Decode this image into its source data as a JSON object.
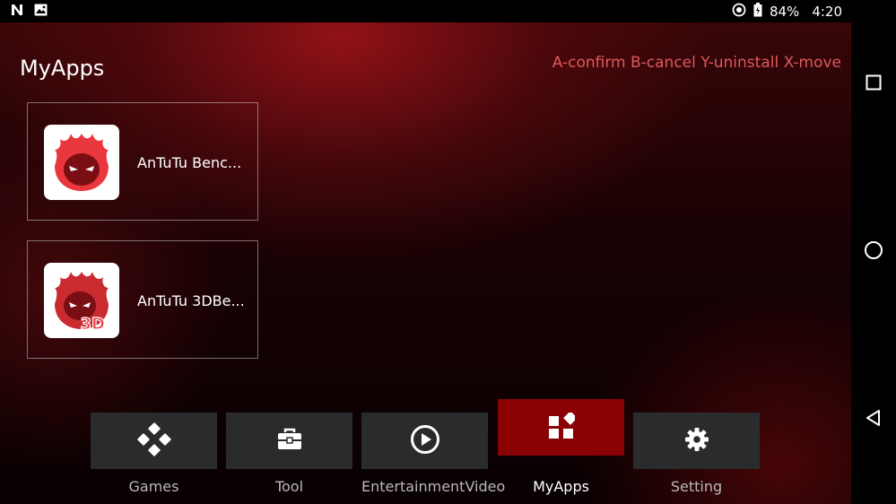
{
  "status_bar": {
    "battery": "84%",
    "time": "4:20"
  },
  "page": {
    "title": "MyApps",
    "hint": "A-confirm B-cancel Y-uninstall X-move"
  },
  "apps": [
    {
      "label": "AnTuTu Benc...",
      "icon": "antutu-icon"
    },
    {
      "label": "AnTuTu 3DBe...",
      "icon": "antutu-3d-icon",
      "badge": "3D"
    }
  ],
  "tabs": [
    {
      "label": "Games",
      "icon": "gamepad-icon",
      "active": false
    },
    {
      "label": "Tool",
      "icon": "toolbox-icon",
      "active": false
    },
    {
      "label": "EntertainmentVideo",
      "icon": "play-icon",
      "active": false
    },
    {
      "label": "MyApps",
      "icon": "apps-grid-icon",
      "active": true
    },
    {
      "label": "Setting",
      "icon": "gear-icon",
      "active": false
    }
  ],
  "colors": {
    "accent": "#8a0203",
    "hint": "#e0585c",
    "tab_bg": "#2a2b2d"
  }
}
